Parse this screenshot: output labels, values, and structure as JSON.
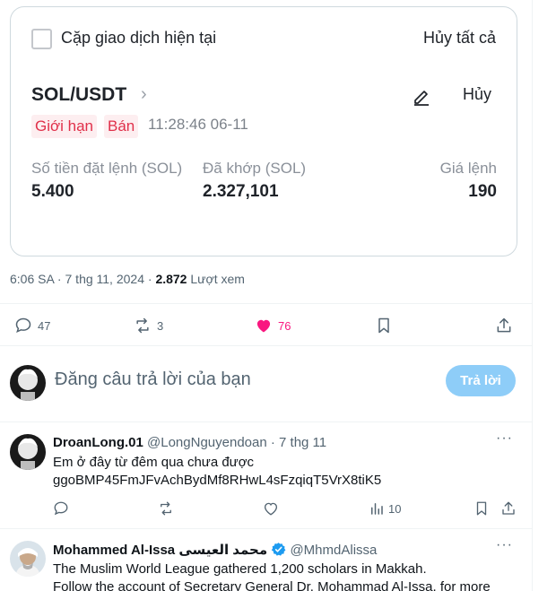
{
  "card": {
    "checkbox_label": "Cặp giao dịch hiện tại",
    "cancel_all": "Hủy tất cả",
    "pair": "SOL/USDT",
    "pair_chevron": "›",
    "cancel": "Hủy",
    "tag_type": "Giới hạn",
    "tag_side": "Bán",
    "timestamp": "11:28:46 06-11",
    "amount_label": "Số tiền đặt lệnh (SOL)",
    "amount_value": "5.400",
    "filled_label": "Đã khớp (SOL)",
    "filled_value": "2.327,101",
    "price_label": "Giá lệnh",
    "price_value": "190",
    "colors": {
      "sell_tag_text": "#e0304a",
      "sell_tag_bg": "#fdeef0"
    }
  },
  "meta": {
    "time": "6:06 SA",
    "sep1": " · ",
    "date": "7 thg 11, 2024",
    "sep2": " · ",
    "views": "2.872",
    "views_label": " Lượt xem"
  },
  "actions": {
    "replies": "47",
    "reposts": "3",
    "likes": "76",
    "like_color": "#f91880"
  },
  "reply_box": {
    "placeholder": "Đăng câu trả lời của bạn",
    "button": "Trả lời"
  },
  "tweets": [
    {
      "name": "DroanLong.01",
      "handle": "@LongNguyendoan",
      "sep": " · ",
      "date": "7 thg 11",
      "more": "···",
      "line1": "Em ở đây từ đêm qua chưa được",
      "line2": "ggoBMP45FmJFvAchBydMf8RHwL4sFzqiqT5VrX8tiK5",
      "views": "10"
    },
    {
      "name": "Mohammed Al-Issa محمد العيسى",
      "handle": "@MhmdAlissa",
      "more": "···",
      "line1": "The Muslim World League gathered 1,200 scholars in Makkah.",
      "line2": "Follow the account of Secretary General Dr. Mohammad Al-Issa, for more"
    }
  ]
}
